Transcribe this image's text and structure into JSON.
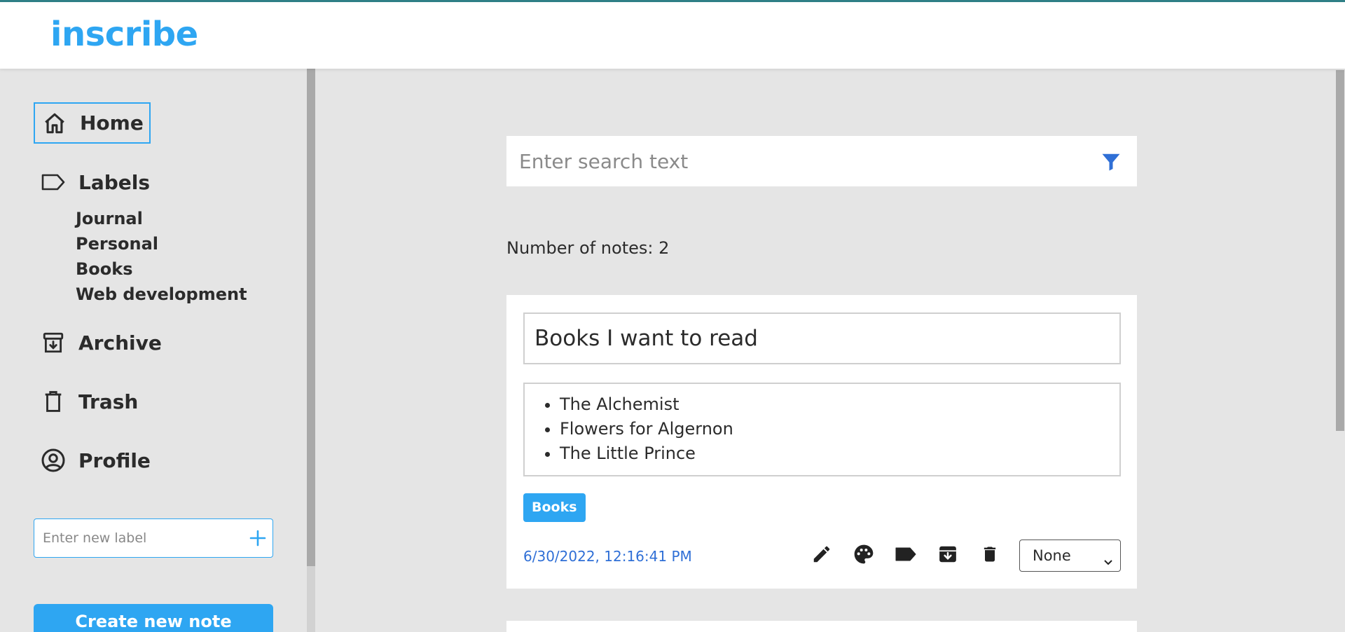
{
  "app": {
    "logo": "inscribe"
  },
  "sidebar": {
    "home": "Home",
    "labels": "Labels",
    "label_items": [
      "Journal",
      "Personal",
      "Books",
      "Web development"
    ],
    "archive": "Archive",
    "trash": "Trash",
    "profile": "Profile",
    "new_label_placeholder": "Enter new label",
    "create_button": "Create new note"
  },
  "main": {
    "search_placeholder": "Enter search text",
    "note_count_text": "Number of notes: 2",
    "notes": [
      {
        "title": "Books I want to read",
        "items": [
          "The Alchemist",
          "Flowers for Algernon",
          "The Little Prince"
        ],
        "tag": "Books",
        "date": "6/30/2022, 12:16:41 PM",
        "color_select": "None"
      }
    ]
  },
  "colors": {
    "accent": "#2ea6f2",
    "date": "#2f6fd6",
    "topbar_border": "#2f7f86"
  },
  "icons": [
    "home-icon",
    "label-icon",
    "archive-icon",
    "trash-icon",
    "profile-icon",
    "plus-icon",
    "filter-icon",
    "edit-icon",
    "palette-icon",
    "tag-icon",
    "archive-action-icon",
    "delete-icon",
    "chevron-down-icon"
  ]
}
